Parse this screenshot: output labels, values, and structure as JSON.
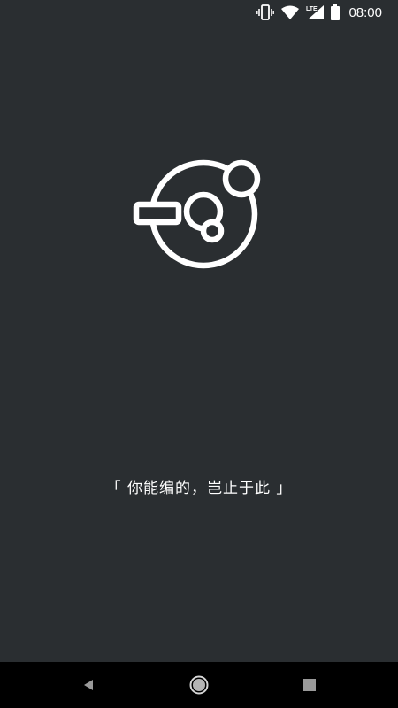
{
  "status_bar": {
    "time": "08:00",
    "network_label": "LTE",
    "icons": [
      "vibrate-icon",
      "wifi-icon",
      "cellular-signal-icon",
      "battery-icon"
    ]
  },
  "splash": {
    "logo_icon": "orbit-logo-icon",
    "slogan": "「 你能编的，岂止于此 」"
  },
  "nav_bar": {
    "buttons": [
      "back-button",
      "home-button",
      "recent-apps-button"
    ]
  },
  "colors": {
    "background": "#2a2e31",
    "nav_background": "#000000",
    "foreground": "#ffffff"
  }
}
